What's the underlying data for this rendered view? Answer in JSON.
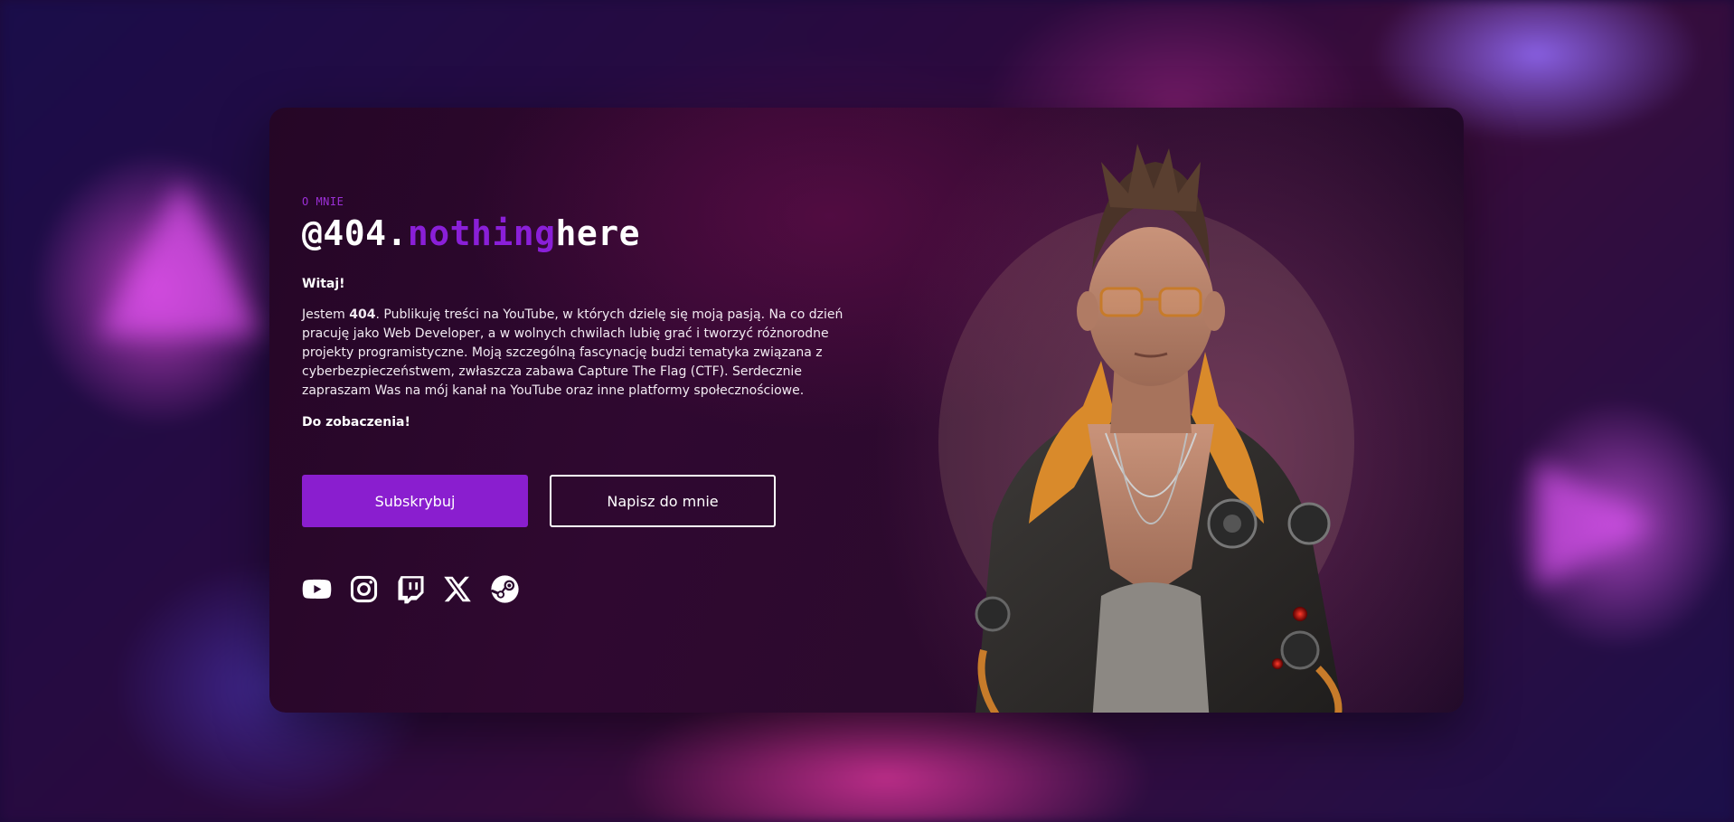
{
  "section": {
    "eyebrow": "O MNIE",
    "title_prefix": "@404.",
    "title_accent": "nothing",
    "title_suffix": "here"
  },
  "intro": {
    "greeting": "Witaj!",
    "para_start": "Jestem ",
    "para_bold": "404",
    "para_rest": ". Publikuję treści na YouTube, w których dzielę się moją pasją. Na co dzień pracuję jako Web Developer, a w wolnych chwilach lubię grać i tworzyć różnorodne projekty programistyczne. Moją szczególną fascynację budzi tematyka związana z cyberbezpieczeństwem, zwłaszcza zabawa Capture The Flag (CTF). Serdecznie zapraszam Was na mój kanał na YouTube oraz inne platformy społecznościowe.",
    "farewell": "Do zobaczenia!"
  },
  "buttons": {
    "subscribe": "Subskrybuj",
    "contact": "Napisz do mnie"
  },
  "socials": [
    "youtube-icon",
    "instagram-icon",
    "twitch-icon",
    "x-icon",
    "steam-icon"
  ],
  "colors": {
    "accent": "#8a1ecf",
    "eyebrow": "#9b2fd6"
  }
}
